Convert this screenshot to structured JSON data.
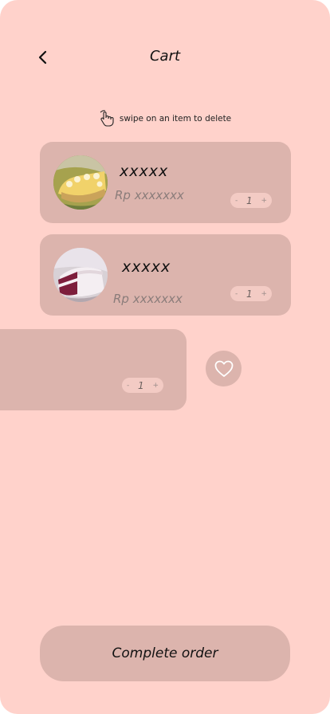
{
  "header": {
    "title": "Cart",
    "back_icon": "chevron-left-icon"
  },
  "hint": {
    "text": "swipe on an item to delete",
    "icon": "swipe-hand-icon"
  },
  "cart": {
    "items": [
      {
        "name": "xxxxx",
        "price": "Rp xxxxxxx",
        "quantity": "1",
        "image": "cheesecake-photo"
      },
      {
        "name": "xxxxx",
        "price": "Rp xxxxxxx",
        "quantity": "1",
        "image": "red-velvet-cake-photo"
      },
      {
        "quantity": "1",
        "state": "swiped-left"
      }
    ],
    "stepper": {
      "minus": "-",
      "plus": "+"
    }
  },
  "favorite": {
    "icon": "heart-icon"
  },
  "footer": {
    "complete_label": "Complete order"
  },
  "colors": {
    "background": "#ffd2cb",
    "card": "#dcb4ad",
    "stepper": "#f3cbc4",
    "text": "#111111",
    "price": "#8a7c7a"
  }
}
